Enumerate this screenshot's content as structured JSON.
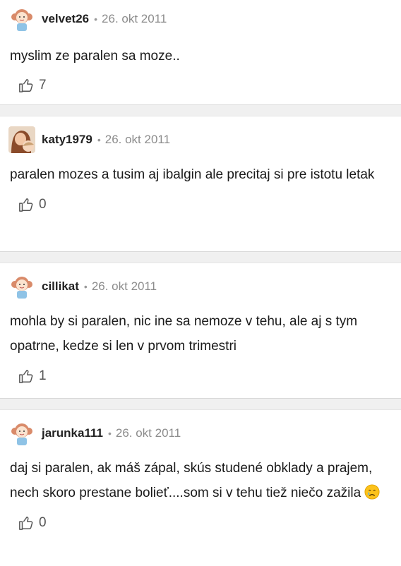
{
  "comments": [
    {
      "user": "velvet26",
      "date": "26. okt 2011",
      "text": "myslim ze paralen sa moze..",
      "likes": "7",
      "avatar": "cartoon-girl"
    },
    {
      "user": "katy1979",
      "date": "26. okt 2011",
      "text": "paralen mozes a tusim aj ibalgin ale precitaj si pre istotu letak",
      "likes": "0",
      "avatar": "photo"
    },
    {
      "user": "cillikat",
      "date": "26. okt 2011",
      "text": "mohla by si paralen, nic ine sa nemoze v tehu, ale aj s tym opatrne, kedze si len v prvom trimestri",
      "likes": "1",
      "avatar": "cartoon-girl"
    },
    {
      "user": "jarunka111",
      "date": "26. okt 2011",
      "text": "daj si paralen, ak máš zápal, skús studené obklady a prajem, nech skoro prestane bolieť....som si v tehu tiež niečo zažila",
      "likes": "0",
      "avatar": "cartoon-girl"
    }
  ],
  "separator": "•",
  "icons": {
    "like": "thumbs-up-icon",
    "emoji": "crying-face-icon"
  },
  "colors": {
    "separator_bg": "#f0f0f0",
    "date": "#8c8c8c"
  }
}
